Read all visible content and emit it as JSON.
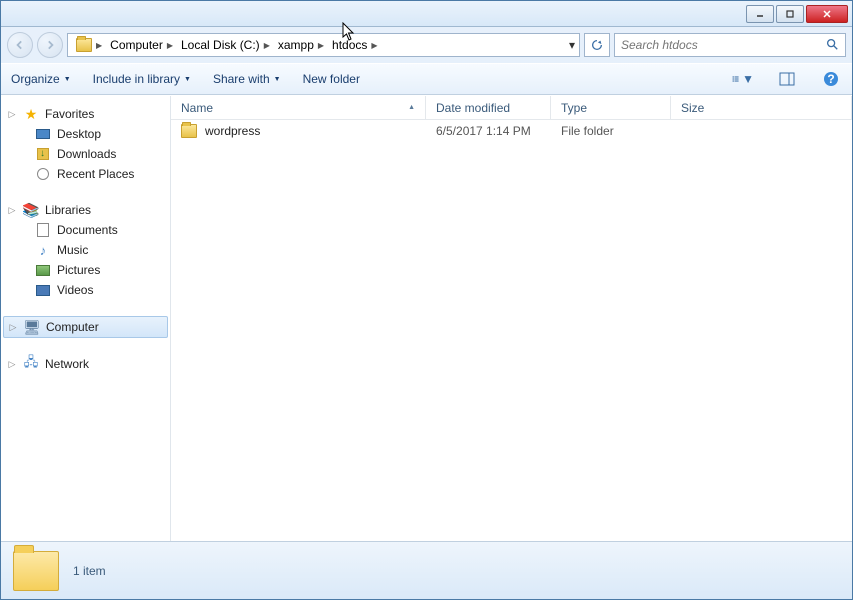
{
  "search": {
    "placeholder": "Search htdocs"
  },
  "breadcrumbs": [
    "Computer",
    "Local Disk (C:)",
    "xampp",
    "htdocs"
  ],
  "toolbar": {
    "organize": "Organize",
    "include": "Include in library",
    "share": "Share with",
    "newfolder": "New folder"
  },
  "sidebar": {
    "favorites": {
      "label": "Favorites",
      "items": [
        "Desktop",
        "Downloads",
        "Recent Places"
      ]
    },
    "libraries": {
      "label": "Libraries",
      "items": [
        "Documents",
        "Music",
        "Pictures",
        "Videos"
      ]
    },
    "computer": {
      "label": "Computer"
    },
    "network": {
      "label": "Network"
    }
  },
  "columns": {
    "name": "Name",
    "date": "Date modified",
    "type": "Type",
    "size": "Size"
  },
  "files": [
    {
      "name": "wordpress",
      "date": "6/5/2017 1:14 PM",
      "type": "File folder",
      "size": ""
    }
  ],
  "status": {
    "count": "1 item"
  }
}
